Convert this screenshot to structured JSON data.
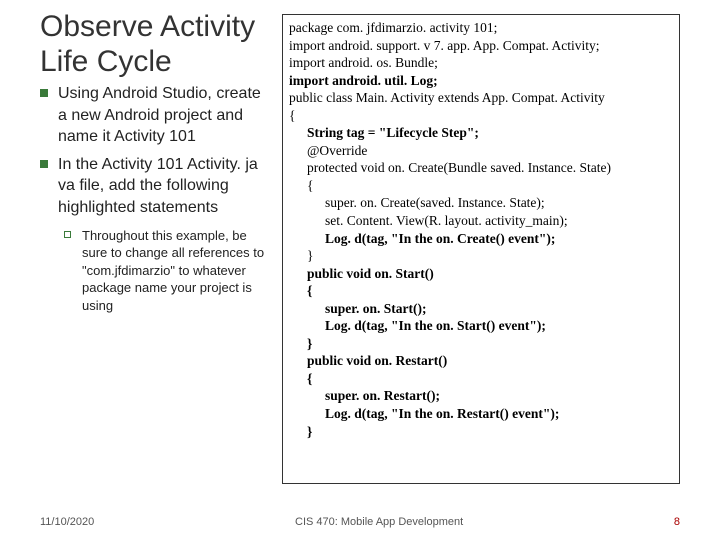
{
  "title": "Observe Activity Life Cycle",
  "bullets": [
    "Using Android Studio, create a new Android project and name it Activity 101",
    "In the Activity 101 Activity. ja va file, add the following highlighted statements"
  ],
  "sub_bullet": "Throughout this example, be sure to change all references to \"com.jfdimarzio\" to whatever package name your project is using",
  "code": {
    "l1": "package com. jfdimarzio. activity 101;",
    "l2": "import android. support. v 7. app. App. Compat. Activity;",
    "l3": "import android. os. Bundle;",
    "l4": "import android. util. Log;",
    "l5": "public class Main. Activity extends App. Compat. Activity",
    "l6": "{",
    "l7": "String tag = \"Lifecycle Step\";",
    "l8": "@Override",
    "l9": "protected void on. Create(Bundle saved. Instance. State)",
    "l10": "{",
    "l11": "super. on. Create(saved. Instance. State);",
    "l12": "set. Content. View(R. layout. activity_main);",
    "l13": "Log. d(tag, \"In the on. Create() event\");",
    "l14": "}",
    "l15": "public void on. Start()",
    "l16": "{",
    "l17": "super. on. Start();",
    "l18": "Log. d(tag, \"In the on. Start() event\");",
    "l19": "}",
    "l20": "public void on. Restart()",
    "l21": "{",
    "l22": "super. on. Restart();",
    "l23": "Log. d(tag, \"In the on. Restart() event\");",
    "l24": "}"
  },
  "footer": {
    "date": "11/10/2020",
    "course": "CIS 470: Mobile App Development",
    "page": "8"
  }
}
